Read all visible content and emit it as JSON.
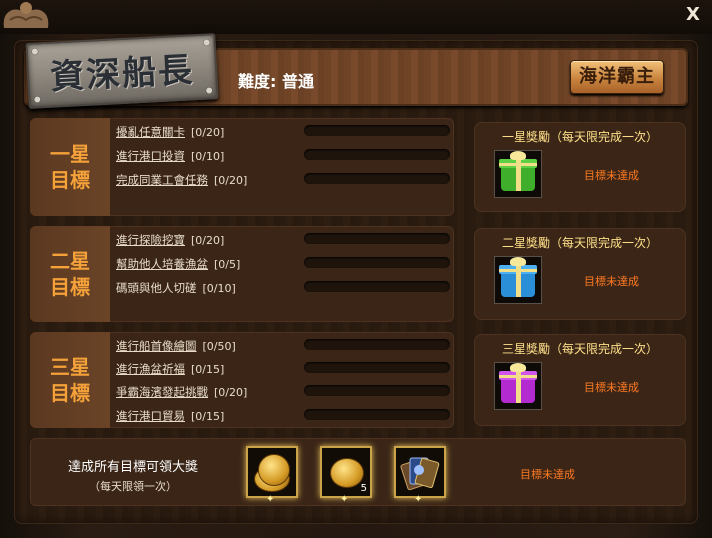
{
  "window": {
    "close_label": "X"
  },
  "header": {
    "title": "資深船長",
    "difficulty": "難度: 普通",
    "ocean_button": "海洋霸主"
  },
  "goals": [
    {
      "star_label": "一星目標",
      "tasks": [
        {
          "name": "擾亂任意關卡",
          "count": "[0/20]",
          "progress": 0
        },
        {
          "name": "進行港口投資",
          "count": "[0/10]",
          "progress": 0
        },
        {
          "name": "完成同業工會任務",
          "count": "[0/20]",
          "progress": 0
        }
      ],
      "reward": {
        "title": "一星獎勵（每天限完成一次）",
        "icon": "green-gift-icon",
        "color": "#3fae2a",
        "status": "目標未達成"
      }
    },
    {
      "star_label": "二星目標",
      "tasks": [
        {
          "name": "進行探險挖寶",
          "count": "[0/20]",
          "progress": 0
        },
        {
          "name": "幫助他人培養漁盆",
          "count": "[0/5]",
          "progress": 0
        },
        {
          "name": "碼頭與他人切磋",
          "count": "[0/10]",
          "progress": 0
        }
      ],
      "reward": {
        "title": "二星獎勵（每天限完成一次）",
        "icon": "blue-gift-icon",
        "color": "#2a8fd6",
        "status": "目標未達成"
      }
    },
    {
      "star_label": "三星目標",
      "tasks": [
        {
          "name": "進行船首像繪圖",
          "count": "[0/50]",
          "progress": 0
        },
        {
          "name": "進行漁盆祈福",
          "count": "[0/15]",
          "progress": 0
        },
        {
          "name": "爭霸海濱發起挑戰",
          "count": "[0/20]",
          "progress": 0
        },
        {
          "name": "進行港口貿易",
          "count": "[0/15]",
          "progress": 0
        }
      ],
      "reward": {
        "title": "三星獎勵（每天限完成一次）",
        "icon": "purple-gift-icon",
        "color": "#b22ad0",
        "status": "目標未達成"
      }
    }
  ],
  "final_reward": {
    "title": "達成所有目標可領大獎",
    "subtitle": "（每天限領一次）",
    "items": [
      {
        "icon": "gold-medal-coin-icon",
        "qty": ""
      },
      {
        "icon": "gold-coin-icon",
        "qty": "5"
      },
      {
        "icon": "card-pack-icon",
        "qty": ""
      }
    ],
    "status": "目標未達成"
  }
}
